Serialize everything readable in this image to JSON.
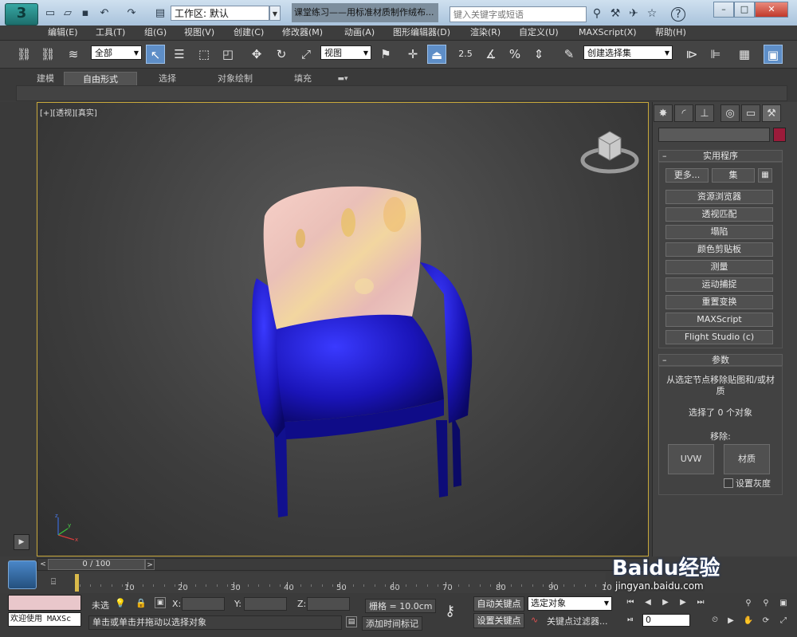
{
  "titlebar": {
    "workspace": "工作区: 默认",
    "doc_title": "课堂练习——用标准材质制作绒布...",
    "search_placeholder": "键入关键字或短语",
    "help": "?"
  },
  "menubar": {
    "items": [
      "编辑(E)",
      "工具(T)",
      "组(G)",
      "视图(V)",
      "创建(C)",
      "修改器(M)",
      "动画(A)",
      "图形编辑器(D)",
      "渲染(R)",
      "自定义(U)",
      "MAXScript(X)",
      "帮助(H)"
    ]
  },
  "toolbar": {
    "selection_filter": "全部",
    "ref_coord": "视图",
    "snap_25": "2.5",
    "named_selection": "创建选择集"
  },
  "ribbon": {
    "tabs": [
      "建模",
      "自由形式",
      "选择",
      "对象绘制",
      "填充"
    ]
  },
  "viewport": {
    "label": "[+][透视][真实]",
    "colors": {
      "chair_frame": "#1a14b8",
      "cushion_pattern": "#f0c8c0",
      "border": "#c8a83b"
    }
  },
  "command_panel": {
    "utilities_header": "实用程序",
    "more_button": "更多...",
    "sets_button": "集",
    "utilities": [
      "资源浏览器",
      "透视匹配",
      "塌陷",
      "颜色剪贴板",
      "测量",
      "运动捕捉",
      "重置变换",
      "MAXScript",
      "Flight Studio (c)"
    ],
    "params_header": "参数",
    "params_desc": "从选定节点移除贴图和/或材质",
    "selected_count": "选择了 0 个对象",
    "remove_label": "移除:",
    "uvw_button": "UVW",
    "material_button": "材质",
    "grayscale_label": "设置灰度"
  },
  "timeline": {
    "frame_display": "0 / 100",
    "ticks": [
      "10",
      "20",
      "30",
      "40",
      "50",
      "60",
      "70",
      "80",
      "90",
      "10"
    ]
  },
  "statusbar": {
    "welcome": "欢迎使用 MAXSc",
    "unselected": "未选",
    "x_label": "X:",
    "y_label": "Y:",
    "z_label": "Z:",
    "grid": "栅格 = 10.0cm",
    "prompt": "单击或单击并拖动以选择对象",
    "add_time_tag": "添加时间标记",
    "auto_key": "自动关键点",
    "set_key": "设置关键点",
    "selected_objects": "选定对象",
    "key_filters": "关键点过滤器...",
    "frame_field": "0"
  },
  "watermark": {
    "brand": "Baidu经验",
    "url": "jingyan.baidu.com"
  }
}
